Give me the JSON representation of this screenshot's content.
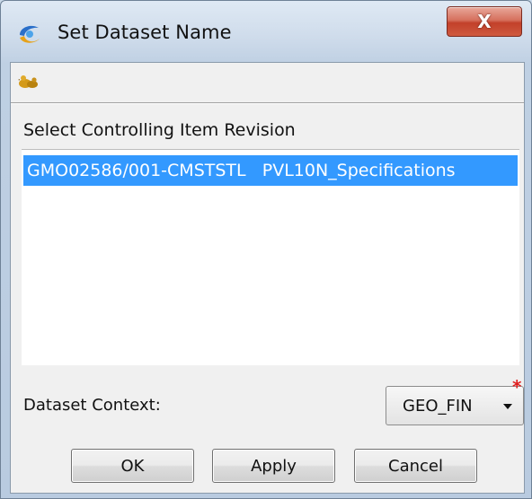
{
  "window": {
    "title": "Set Dataset Name",
    "close_label": "X"
  },
  "toolbar": {
    "icon": "ducks-icon"
  },
  "controlling_item": {
    "label": "Select Controlling Item Revision",
    "items": [
      {
        "label": "GMO02586/001-CMSTSTL   PVL10N_Specifications",
        "selected": true
      }
    ]
  },
  "dataset_context": {
    "label": "Dataset Context:",
    "value": "GEO_FIN",
    "required_marker": "*"
  },
  "buttons": {
    "ok": "OK",
    "apply": "Apply",
    "cancel": "Cancel"
  },
  "colors": {
    "selection": "#3399ff",
    "close_button": "#c2402a",
    "required": "#e02020"
  }
}
